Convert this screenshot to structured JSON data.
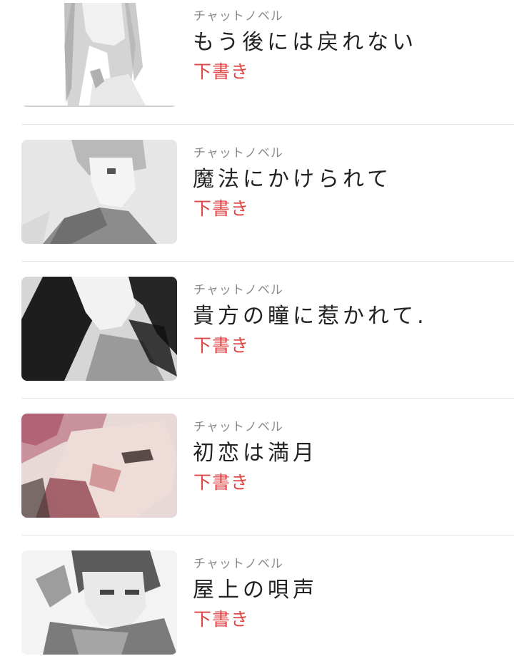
{
  "drafts": [
    {
      "category": "チャットノベル",
      "title": "もう後には戻れない",
      "status": "下書き",
      "thumbnail": "manga-girl-long-hair-image"
    },
    {
      "category": "チャットノベル",
      "title": "魔法にかけられて",
      "status": "下書き",
      "thumbnail": "manga-boy-short-hair-image"
    },
    {
      "category": "チャットノベル",
      "title": "貴方の瞳に惹かれて.",
      "status": "下書き",
      "thumbnail": "manga-girl-dark-hair-image"
    },
    {
      "category": "チャットノベル",
      "title": "初恋は満月",
      "status": "下書き",
      "thumbnail": "manga-man-pink-hair-image"
    },
    {
      "category": "チャットノベル",
      "title": "屋上の唄声",
      "status": "下書き",
      "thumbnail": "manga-boy-scarf-image"
    }
  ],
  "colors": {
    "status": "#e04545",
    "title": "#222222",
    "category": "#8a8a8a",
    "divider": "#e2e2e2"
  }
}
